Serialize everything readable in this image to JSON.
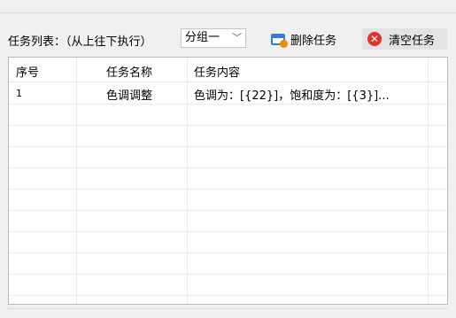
{
  "toolbar": {
    "label": "任务列表：（从上往下执行）",
    "group_selected": "分组一",
    "delete_label": "删除任务",
    "clear_label": "清空任务"
  },
  "table": {
    "columns": [
      "序号",
      "任务名称",
      "任务内容"
    ],
    "rows": [
      {
        "index": "1",
        "name": "色调调整",
        "content": "色调为：[{22}]，饱和度为：[{3}]..."
      }
    ]
  },
  "colors": {
    "delete_icon": "#3a7bd5",
    "clear_icon": "#e0332c"
  },
  "icons": [
    "window-delete-icon",
    "clear-x-icon",
    "chevron-down-icon"
  ]
}
